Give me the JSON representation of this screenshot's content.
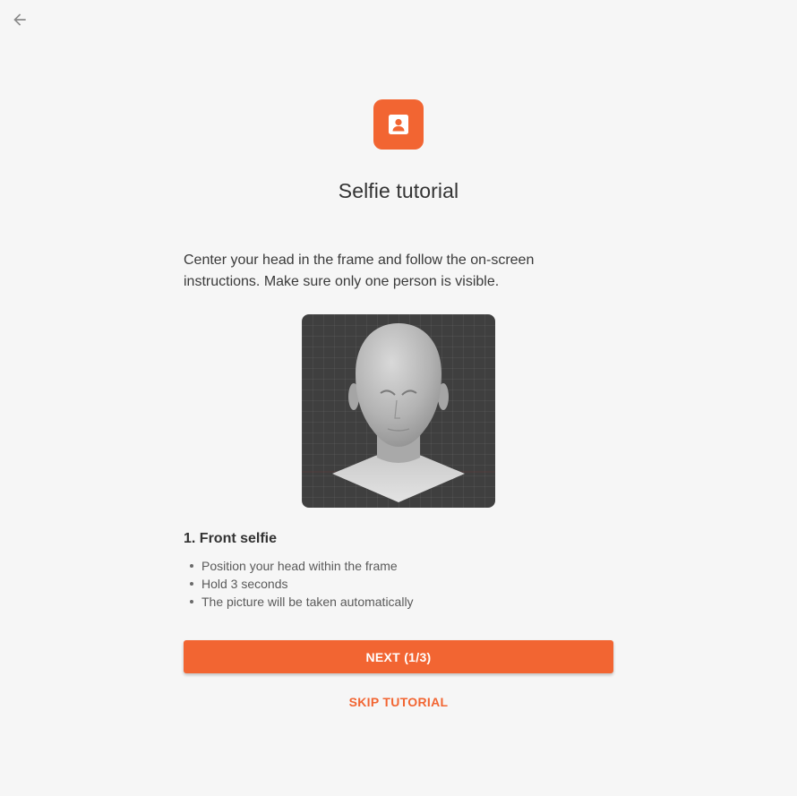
{
  "nav": {
    "back_icon": "arrow-left-icon"
  },
  "header": {
    "icon": "id-badge-icon",
    "title": "Selfie tutorial"
  },
  "intro_text": "Center your head in the frame and follow the on-screen instructions. Make sure only one person is visible.",
  "illustration": {
    "subject": "3d-head-front-view"
  },
  "step": {
    "title": "1. Front selfie",
    "items": [
      "Position your head within the frame",
      "Hold 3 seconds",
      "The picture will be taken automatically"
    ]
  },
  "actions": {
    "next_label": "NEXT (1/3)",
    "skip_label": "SKIP TUTORIAL"
  },
  "colors": {
    "accent": "#f26532",
    "background": "#f6f6f6",
    "illustration_bg": "#3f3f3f"
  }
}
